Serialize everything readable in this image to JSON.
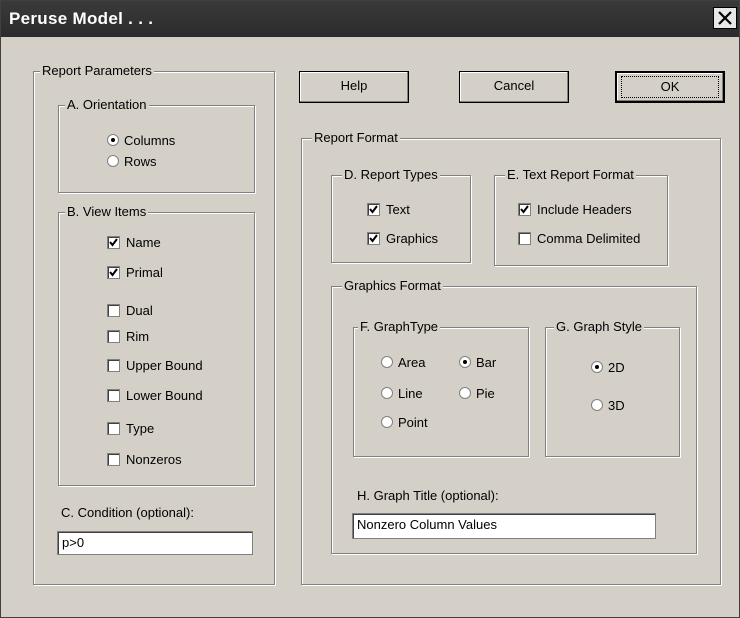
{
  "window": {
    "title": "Peruse Model . . ."
  },
  "buttons": {
    "help": "Help",
    "cancel": "Cancel",
    "ok": "OK"
  },
  "report_parameters": {
    "label": "Report Parameters",
    "orientation": {
      "label": "A. Orientation",
      "options": [
        "Columns",
        "Rows"
      ],
      "selected": "Columns"
    },
    "view_items": {
      "label": "B. View Items",
      "items": [
        {
          "label": "Name",
          "checked": true
        },
        {
          "label": "Primal",
          "checked": true
        },
        {
          "label": "Dual",
          "checked": false
        },
        {
          "label": "Rim",
          "checked": false
        },
        {
          "label": "Upper Bound",
          "checked": false
        },
        {
          "label": "Lower Bound",
          "checked": false
        },
        {
          "label": "Type",
          "checked": false
        },
        {
          "label": "Nonzeros",
          "checked": false
        }
      ]
    },
    "condition": {
      "label": "C. Condition (optional):",
      "value": "p>0"
    }
  },
  "report_format": {
    "label": "Report Format",
    "report_types": {
      "label": "D. Report Types",
      "items": [
        {
          "label": "Text",
          "checked": true
        },
        {
          "label": "Graphics",
          "checked": true
        }
      ]
    },
    "text_report_format": {
      "label": "E. Text Report Format",
      "items": [
        {
          "label": "Include Headers",
          "checked": true
        },
        {
          "label": "Comma Delimited",
          "checked": false
        }
      ]
    },
    "graphics_format": {
      "label": "Graphics Format",
      "graph_type": {
        "label": "F. GraphType",
        "options": [
          "Area",
          "Bar",
          "Line",
          "Pie",
          "Point"
        ],
        "selected": "Bar"
      },
      "graph_style": {
        "label": "G. Graph Style",
        "options": [
          "2D",
          "3D"
        ],
        "selected": "2D"
      },
      "graph_title": {
        "label": "H. Graph Title (optional):",
        "value": "Nonzero Column Values"
      }
    }
  }
}
